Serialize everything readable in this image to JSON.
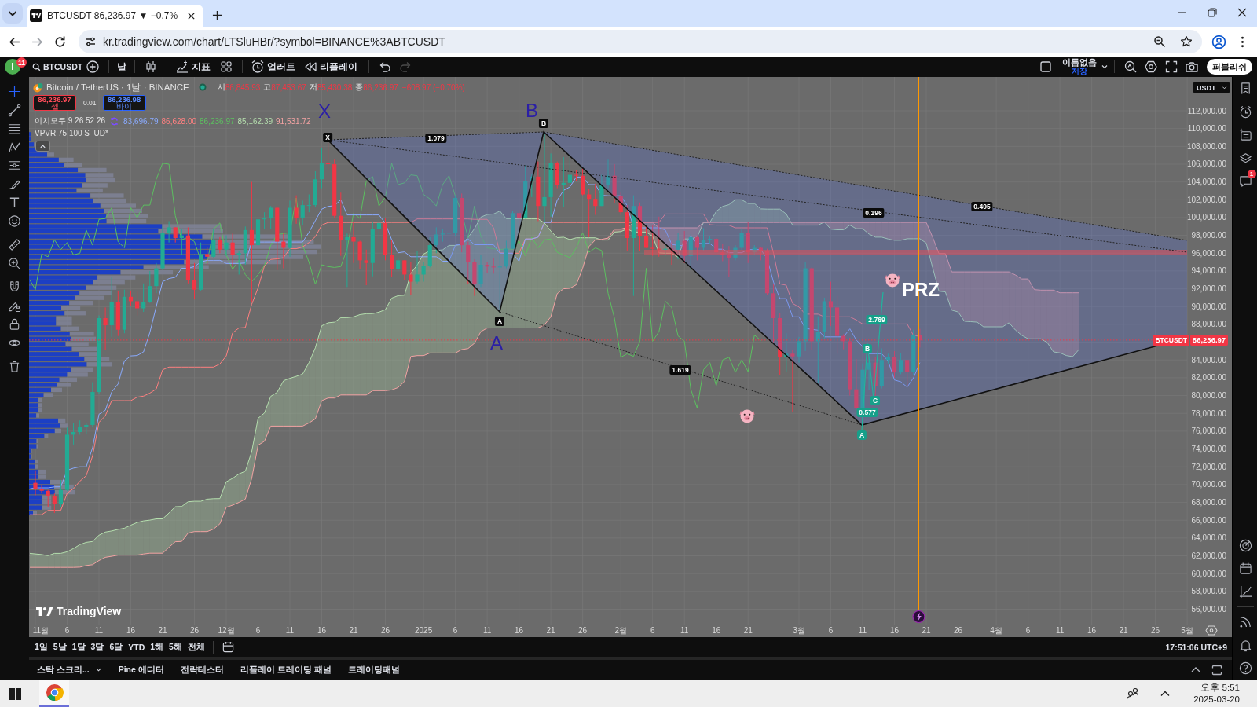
{
  "browser": {
    "tabs": [
      {
        "title": "BTCUSDT 86,236.97 ▼ −0.7%",
        "selected": true
      }
    ],
    "can_go_forward": false,
    "url": "kr.tradingview.com/chart/LTSluHBr/?symbol=BINANCE%3ABTCUSDT"
  },
  "toolbar": {
    "avatar": "I",
    "notifications": "11",
    "symbol": "BTCUSDT",
    "interval": "날",
    "indicators": "지표",
    "alerts": "얼러트",
    "replay": "리플레이",
    "can_undo": true,
    "can_redo": false,
    "layout_name": "이름없음",
    "layout_status": "저장",
    "publish": "퍼블리쉬"
  },
  "left_toolbar": {
    "crosshair_active": true
  },
  "legend": {
    "title": "Bitcoin / TetherUS · 1날 · BINANCE",
    "market_open": true,
    "falling": true,
    "ohlc": [
      {
        "label": "시",
        "value": "86,845.93"
      },
      {
        "label": "고",
        "value": "87,453.67"
      },
      {
        "label": "저",
        "value": "85,430.38"
      },
      {
        "label": "종",
        "value": "86,236.97"
      }
    ],
    "change": "−608.97 (−0.70%)",
    "sell": {
      "price": "86,236.97",
      "label": "셀"
    },
    "spread": "0.01",
    "buy": {
      "price": "86,236.98",
      "label": "바이"
    },
    "ichimoku": {
      "name": "이치모쿠 9 26 52 26",
      "values": [
        {
          "text": "83,696.79",
          "color": "#8aabff"
        },
        {
          "text": "86,628.00",
          "color": "#ff8080"
        },
        {
          "text": "86,236.97",
          "color": "#5cc060"
        },
        {
          "text": "85,162.39",
          "color": "#b5dfae"
        },
        {
          "text": "91,531.72",
          "color": "#f3a3a3"
        }
      ]
    },
    "vpvr": "VPVR 75 100 S_UD*"
  },
  "chart": {
    "currency": "USDT",
    "price_ticks": [
      "112,000.00",
      "110,000.00",
      "108,000.00",
      "106,000.00",
      "104,000.00",
      "102,000.00",
      "100,000.00",
      "98,000.00",
      "96,000.00",
      "94,000.00",
      "92,000.00",
      "90,000.00",
      "88,000.00",
      "84,000.00",
      "82,000.00",
      "80,000.00",
      "78,000.00",
      "76,000.00",
      "74,000.00",
      "72,000.00",
      "70,000.00",
      "68,000.00",
      "66,000.00",
      "64,000.00",
      "62,000.00",
      "60,000.00",
      "58,000.00",
      "56,000.00"
    ],
    "time_ticks": [
      "11월",
      "6",
      "11",
      "16",
      "21",
      "26",
      "12월",
      "6",
      "11",
      "16",
      "21",
      "26",
      "2025",
      "6",
      "11",
      "16",
      "21",
      "26",
      "2월",
      "6",
      "11",
      "16",
      "21",
      "3월",
      "6",
      "11",
      "16",
      "21",
      "26",
      "4월",
      "6",
      "11",
      "16",
      "21",
      "26",
      "5월"
    ],
    "last_price": {
      "symbol": "BTCUSDT",
      "price": "86,236.97"
    },
    "pattern_labels": [
      {
        "text": "X",
        "kind": "vertex"
      },
      {
        "text": "B",
        "kind": "vertex"
      },
      {
        "text": "B",
        "kind": "tag"
      },
      {
        "text": "X",
        "kind": "tag"
      },
      {
        "text": "1.079",
        "kind": "tag"
      },
      {
        "text": "0.495",
        "kind": "tag"
      },
      {
        "text": "0.196",
        "kind": "tag"
      },
      {
        "text": "2.769",
        "kind": "subtag"
      },
      {
        "text": "A",
        "kind": "tag"
      },
      {
        "text": "A",
        "kind": "vertex"
      },
      {
        "text": "B",
        "kind": "subtag"
      },
      {
        "text": "1.619",
        "kind": "tag"
      },
      {
        "text": "C",
        "kind": "subtag"
      },
      {
        "text": "0.577",
        "kind": "subtag"
      },
      {
        "text": "A",
        "kind": "subtag"
      }
    ],
    "zone_label": "PRZ",
    "logo": "TradingView"
  },
  "range_bar": {
    "ranges": [
      "1일",
      "5날",
      "1달",
      "3달",
      "6달",
      "YTD",
      "1해",
      "5해",
      "전체"
    ],
    "clock": "17:51:06 UTC+9"
  },
  "bottom_panel": {
    "tabs": [
      {
        "label": "스탁 스크리...",
        "menu": true
      },
      {
        "label": "Pine 에디터",
        "menu": false
      },
      {
        "label": "전략테스터",
        "menu": false
      },
      {
        "label": "리플레이 트레이딩 패널",
        "menu": false
      },
      {
        "label": "트레이딩패널",
        "menu": false
      }
    ]
  },
  "right_toolbar": {
    "chat_badge": "1"
  },
  "taskbar": {
    "browser_running": true,
    "time": "오후 5:51",
    "date": "2025-03-20"
  }
}
